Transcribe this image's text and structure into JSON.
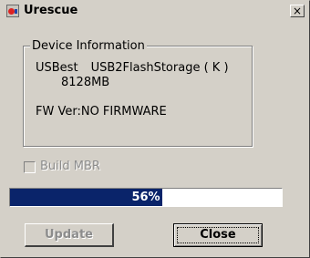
{
  "window": {
    "title": "Urescue",
    "close_glyph": "×"
  },
  "device_info": {
    "group_title": "Device Information",
    "vendor": "USBest",
    "product": "USB2FlashStorage ( K )",
    "capacity": "8128MB",
    "firmware": "FW Ver:NO FIRMWARE"
  },
  "build_mbr": {
    "label": "Build MBR",
    "checked": false,
    "enabled": false
  },
  "progress": {
    "label": "56%",
    "fraction": 0.56
  },
  "buttons": {
    "update_label": "Update",
    "update_enabled": false,
    "close_label": "Close"
  },
  "colors": {
    "progress_fill": "#0a246a",
    "face": "#d4d0c8"
  }
}
